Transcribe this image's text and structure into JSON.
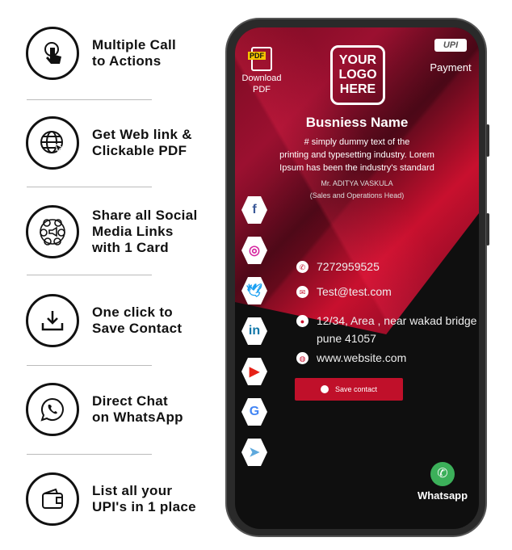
{
  "features": [
    {
      "label": "Multiple Call\nto Actions",
      "icon": "touch-icon"
    },
    {
      "label": "Get Web link &\nClickable PDF",
      "icon": "globe-cursor-icon"
    },
    {
      "label": "Share all Social\nMedia Links\nwith 1 Card",
      "icon": "social-icon"
    },
    {
      "label": "One click to\nSave Contact",
      "icon": "download-icon"
    },
    {
      "label": "Direct Chat\non WhatsApp",
      "icon": "whatsapp-icon"
    },
    {
      "label": "List all your\nUPI's in 1 place",
      "icon": "wallet-icon"
    }
  ],
  "card": {
    "pdf_badge": "PDF",
    "download_label": "Download\nPDF",
    "logo_text": "YOUR\nLOGO\nHERE",
    "upi_badge": "UPI",
    "payment_label": "Payment",
    "business_name": "Busniess Name",
    "tagline": "# simply dummy text of the\nprinting and typesetting industry. Lorem\nIpsum has been the industry's standard",
    "person": "Mr. ADITYA VASKULA",
    "role": "(Sales and Operations Head)",
    "phone": "7272959525",
    "email": "Test@test.com",
    "address": "12/34, Area , near wakad bridge\npune 41057",
    "website": "www.website.com",
    "save_label": "Save contact",
    "whatsapp_label": "Whatsapp",
    "social": [
      {
        "name": "facebook",
        "glyph": "f",
        "color": "#3b5998"
      },
      {
        "name": "instagram",
        "glyph": "◎",
        "color": "#d6249f"
      },
      {
        "name": "twitter",
        "glyph": "🕊",
        "color": "#1da1f2"
      },
      {
        "name": "linkedin",
        "glyph": "in",
        "color": "#0e76a8"
      },
      {
        "name": "youtube",
        "glyph": "▶",
        "color": "#e62117"
      },
      {
        "name": "google-business",
        "glyph": "G",
        "color": "#4285f4"
      },
      {
        "name": "telegram",
        "glyph": "➤",
        "color": "#5ea9dd"
      }
    ],
    "accent": "#c8102e"
  }
}
